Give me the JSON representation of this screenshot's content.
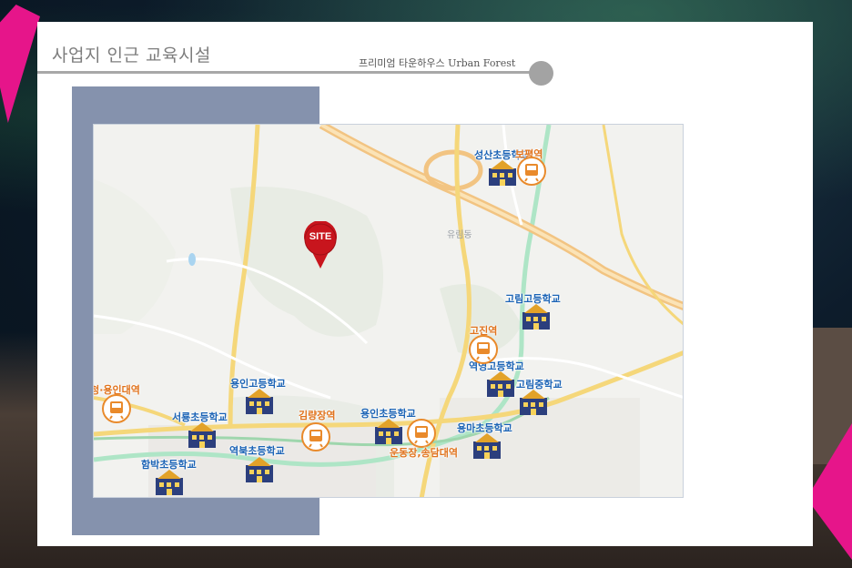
{
  "header": {
    "title": "사업지 인근 교육시설",
    "subtitle": "프리미엄 타운하우스 Urban Forest"
  },
  "map": {
    "site_label": "SITE",
    "place_label": "유림동",
    "schools": [
      {
        "label": "성산초등학교"
      },
      {
        "label": "고림고등학교"
      },
      {
        "label": "역영고등학교"
      },
      {
        "label": "고림중학교"
      },
      {
        "label": "용마초등학교"
      },
      {
        "label": "용인초등학교"
      },
      {
        "label": "용인고등학교"
      },
      {
        "label": "서룡초등학교"
      },
      {
        "label": "역북초등학교"
      },
      {
        "label": "함박초등학교"
      }
    ],
    "stations": [
      {
        "label": "보평역"
      },
      {
        "label": "고진역"
      },
      {
        "label": "시청·용인대역"
      },
      {
        "label": "김량장역"
      },
      {
        "label": "운동장,송담대역"
      }
    ]
  },
  "colors": {
    "accent_pink": "#e6158a",
    "panel_blue": "#8592ad",
    "school_label": "#1b63b5",
    "station_label": "#e0731d",
    "site_pin": "#c8151d"
  }
}
